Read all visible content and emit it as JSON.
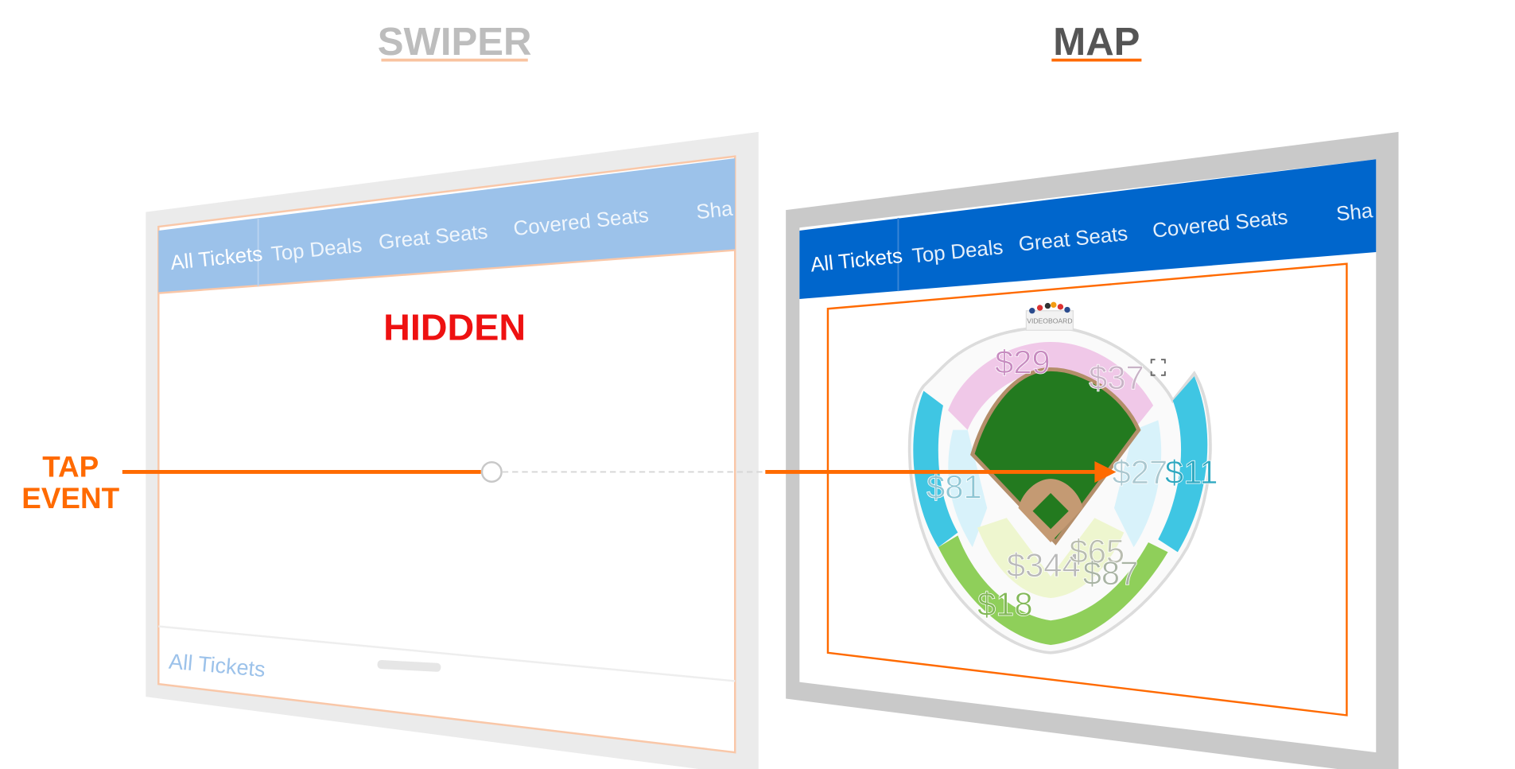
{
  "titles": {
    "swiper": "SWIPER",
    "map": "MAP"
  },
  "swiper_panel": {
    "overlay_label": "HIDDEN",
    "tabs": [
      "All Tickets",
      "Top Deals",
      "Great Seats",
      "Covered Seats",
      "Sha"
    ],
    "footer_label": "All Tickets"
  },
  "map_panel": {
    "tabs": [
      "All Tickets",
      "Top Deals",
      "Great Seats",
      "Covered Seats",
      "Sha"
    ],
    "stadium": {
      "videoboard_label": "VIDEOBOARD",
      "prices": [
        "$29",
        "$37",
        "$27",
        "$11",
        "$81",
        "$344",
        "$65",
        "$87",
        "$18"
      ]
    }
  },
  "annotation": {
    "line1": "TAP",
    "line2": "EVENT"
  },
  "colors": {
    "accent_orange": "#ff6a00",
    "hidden_red": "#ee1111",
    "tab_blue": "#0066cc",
    "tab_blue_faded": "#9cc2ea",
    "section_pink": "#f0c8e8",
    "section_cyan": "#3fc6e3",
    "section_green": "#8fcf5a",
    "field_green": "#237a1f"
  }
}
